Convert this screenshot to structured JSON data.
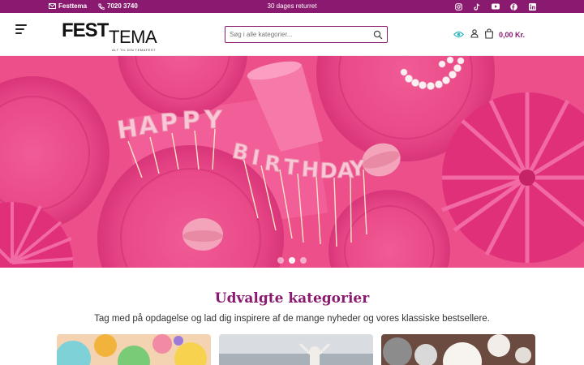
{
  "topbar": {
    "email_label": "Festtema",
    "phone_label": "7020 3740",
    "center_text": "30 dages returret",
    "social": [
      "instagram-icon",
      "tiktok-icon",
      "youtube-icon",
      "facebook-icon",
      "linkedin-icon"
    ]
  },
  "header": {
    "logo_word1": "FEST",
    "logo_word2": "TEMA",
    "logo_tagline": "ALT TIL DIN TEMAFEST",
    "search_placeholder": "Søg i alle kategorier...",
    "cart_total": "0,00 Kr."
  },
  "hero": {
    "letters1": [
      "H",
      "A",
      "P",
      "P",
      "Y"
    ],
    "letters2": [
      "B",
      "I",
      "R",
      "T",
      "H",
      "D",
      "A",
      "Y"
    ],
    "slide_count": 3,
    "active_slide": 2
  },
  "section": {
    "title": "Udvalgte kategorier",
    "subtitle": "Tag med på opdagelse og lad dig inspirere af de mange nyheder og vores klassiske bestsellere."
  },
  "colors": {
    "brand": "#8a1a6f",
    "hero_pink": "#e8437f",
    "eye_icon": "#2bb3c0"
  }
}
